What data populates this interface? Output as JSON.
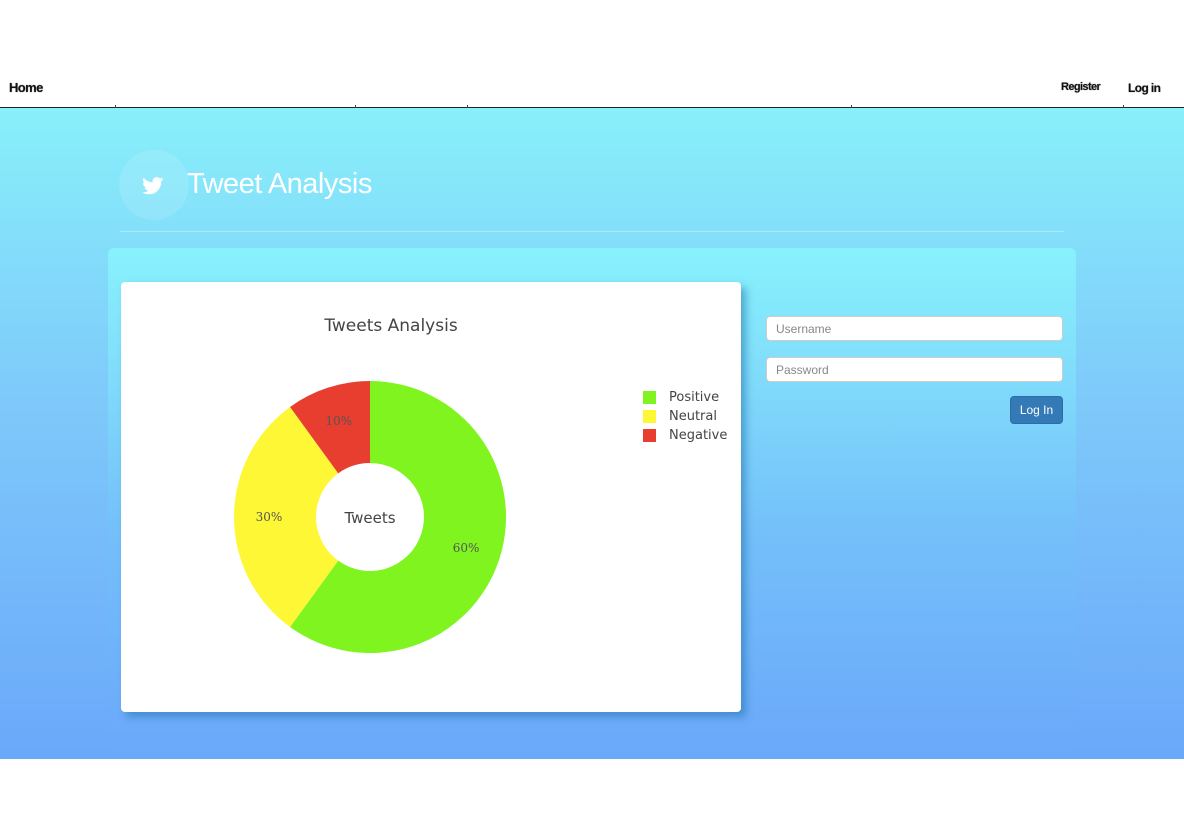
{
  "nav": {
    "home": "Home",
    "register": "Register",
    "login": "Log in"
  },
  "header": {
    "logo_icon": "twitter-bird-icon",
    "title": "Tweet Analysis"
  },
  "login_form": {
    "username_placeholder": "Username",
    "password_placeholder": "Password",
    "submit_label": "Log In"
  },
  "colors": {
    "positive": "#7ff41f",
    "neutral": "#fdf735",
    "negative": "#e83e30",
    "button": "#337ab7"
  },
  "chart_data": {
    "type": "pie",
    "title": "Tweets Analysis",
    "center_label": "Tweets",
    "categories": [
      "Positive",
      "Neutral",
      "Negative"
    ],
    "values": [
      60,
      30,
      10
    ],
    "labels": [
      "60%",
      "30%",
      "10%"
    ],
    "legend_position": "right"
  }
}
